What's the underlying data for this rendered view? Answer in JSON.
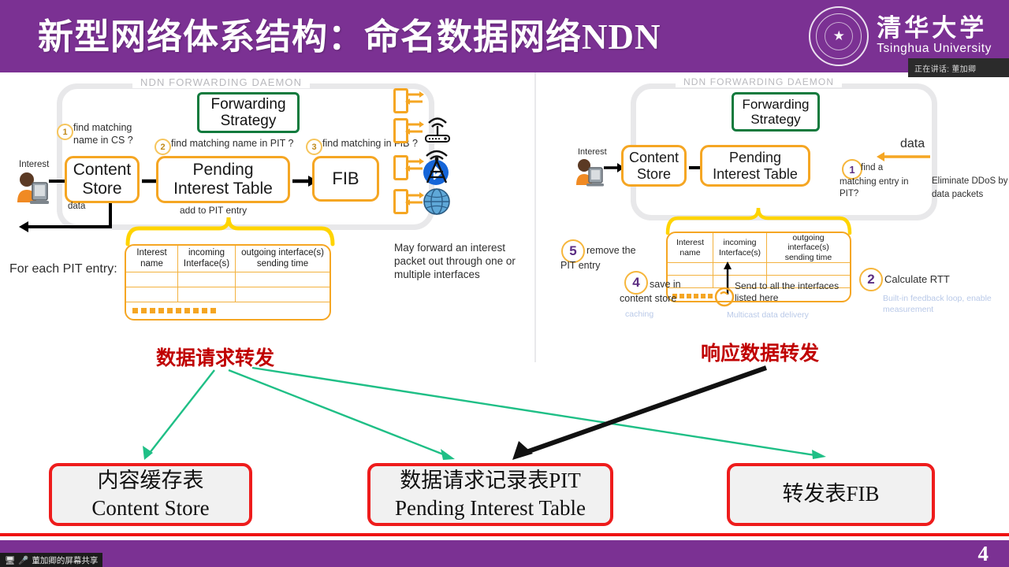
{
  "header": {
    "title": "新型网络体系结构：命名数据网络NDN",
    "university_cn": "清华大学",
    "university_en": "Tsinghua University",
    "speaker_badge": "正在讲话: 董加卿"
  },
  "left_panel": {
    "daemon_label": "NDN FORWARDING DAEMON",
    "forwarding_strategy": "Forwarding\nStrategy",
    "fs_line1": "Forwarding",
    "fs_line2": "Strategy",
    "interest_label": "Interest",
    "data_label": "data",
    "content_store_l1": "Content",
    "content_store_l2": "Store",
    "pit_l1": "Pending",
    "pit_l2": "Interest Table",
    "fib": "FIB",
    "step1_num": "1",
    "step1_text_l1": "find matching",
    "step1_text_l2": "name in CS ?",
    "step2_num": "2",
    "step2_text": "find matching name in PIT ?",
    "step3_num": "3",
    "step3_text": "find matching in FIB ?",
    "add_to_pit": "add to PIT entry",
    "for_each_pit": "For each PIT entry:",
    "table_headers": [
      {
        "l1": "Interest",
        "l2": "name"
      },
      {
        "l1": "incoming",
        "l2": "Interface(s)"
      },
      {
        "l1": "outgoing interface(s)",
        "l2": "sending time"
      }
    ],
    "note_l1": "May forward an interest",
    "note_l2": "packet out through one or",
    "note_l3": "multiple interfaces",
    "interfaces": [
      "bluetooth-icon",
      "wifi-router-icon",
      "cell-tower-icon",
      "globe-icon"
    ]
  },
  "right_panel": {
    "daemon_label": "NDN FORWARDING DAEMON",
    "fs_line1": "Forwarding",
    "fs_line2": "Strategy",
    "interest_label": "Interest",
    "data_label": "data",
    "content_store_l1": "Content",
    "content_store_l2": "Store",
    "pit_l1": "Pending",
    "pit_l2": "Interest Table",
    "step1_num": "1",
    "step1_l1": "find a",
    "step1_l2": "matching entry in",
    "step1_l3": "PIT?",
    "ddos_l1": "Eliminate DDoS by",
    "ddos_l2": "data packets",
    "step2_num": "2",
    "step2_text": "Calculate RTT",
    "step2_note_l1": "Built-in feedback loop, enable",
    "step2_note_l2": "measurement",
    "step4_num": "4",
    "step4_l1": "save in",
    "step4_l2": "content store",
    "step4_note": "caching",
    "step5_num": "5",
    "step5_l1": "remove the",
    "step5_l2": "PIT entry",
    "table_headers": [
      {
        "l1": "Interest",
        "l2": "name"
      },
      {
        "l1": "incoming",
        "l2": "Interface(s)"
      },
      {
        "l1": "outgoing",
        "l2": "interface(s)",
        "l3": "sending time"
      }
    ],
    "send_all_l1": "Send to all the interfaces",
    "send_all_l2": "listed here",
    "multicast_note": "Multicast data delivery"
  },
  "annotations": {
    "left_red_label": "数据请求转发",
    "right_red_label": "响应数据转发"
  },
  "bottom_boxes": [
    {
      "cn": "内容缓存表",
      "en": "Content Store"
    },
    {
      "cn": "数据请求记录表PIT",
      "en": "Pending Interest Table"
    },
    {
      "cn": "转发表FIB",
      "en": ""
    }
  ],
  "footer": {
    "page_number": "4",
    "share_label": "董加卿的屏幕共享"
  },
  "colors": {
    "brand_purple": "#7b3193",
    "accent_orange": "#f5a623",
    "green": "#117a3d",
    "red": "#ee1c1c",
    "red_text": "#c00000",
    "arrow_green": "#1fbf86"
  }
}
